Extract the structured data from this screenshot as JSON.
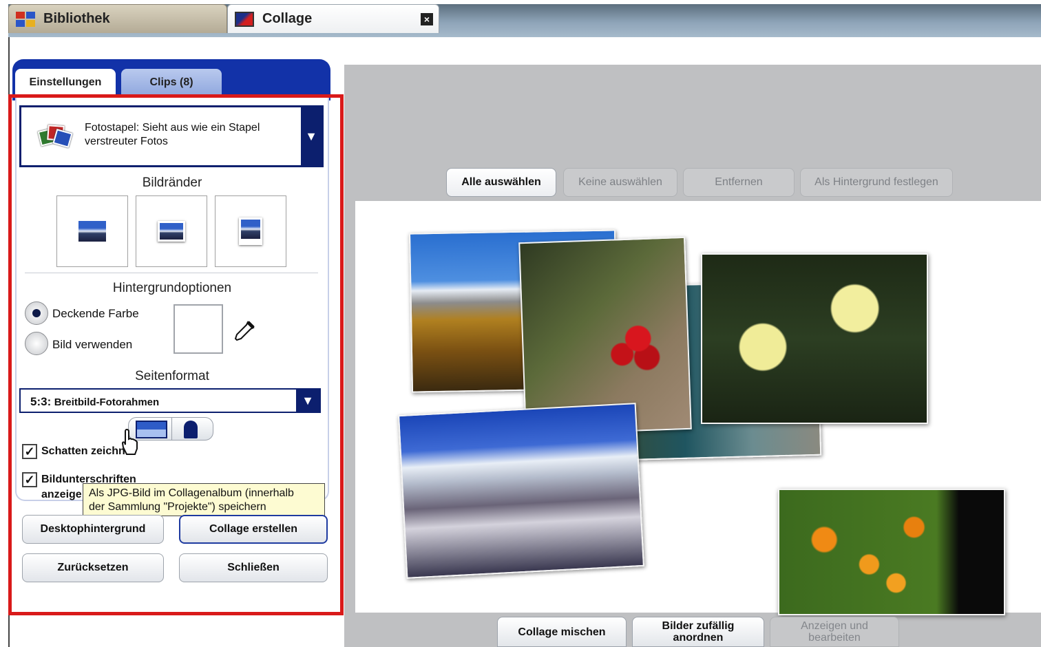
{
  "tabs": {
    "library_label": "Bibliothek",
    "collage_label": "Collage",
    "close_glyph": "×"
  },
  "panel_tabs": {
    "settings": "Einstellungen",
    "clips": "Clips (8)"
  },
  "style_select": {
    "value_line1": "Fotostapel: Sieht aus wie ein Stapel",
    "value_line2": "verstreuter Fotos",
    "arrow": "▼"
  },
  "frames": {
    "title": "Bildränder"
  },
  "background": {
    "title": "Hintergrundoptionen",
    "option_solid": "Deckende Farbe",
    "option_image": "Bild verwenden",
    "selected": "Deckende Farbe",
    "color": "#ffffff"
  },
  "page_format": {
    "title": "Seitenformat",
    "value_ratio": "5:3:",
    "value_name": "Breitbild-Fotorahmen",
    "arrow": "▼"
  },
  "checkboxes": {
    "shadows_label": "Schatten zeichn",
    "shadows_checked": true,
    "captions_label": "Bildunterschriften",
    "captions_label2": "anzeige",
    "captions_checked": true,
    "check_glyph": "✓"
  },
  "tooltip": {
    "line1": "Als JPG-Bild im Collagenalbum (innerhalb",
    "line2": "der Sammlung \"Projekte\") speichern"
  },
  "actions": {
    "desktop": "Desktophintergrund",
    "create": "Collage erstellen",
    "reset": "Zurücksetzen",
    "close": "Schließen"
  },
  "toolbar": {
    "select_all": "Alle auswählen",
    "select_none": "Keine auswählen",
    "remove": "Entfernen",
    "set_background": "Als Hintergrund festlegen"
  },
  "bottom_toolbar": {
    "shuffle": "Collage mischen",
    "random_line1": "Bilder zufällig",
    "random_line2": "anordnen",
    "view_line1": "Anzeigen und",
    "view_line2": "bearbeiten"
  },
  "colors": {
    "accent_blue": "#1232a8",
    "highlight_red": "#d91a1a",
    "tooltip_bg": "#fdfbd2"
  }
}
